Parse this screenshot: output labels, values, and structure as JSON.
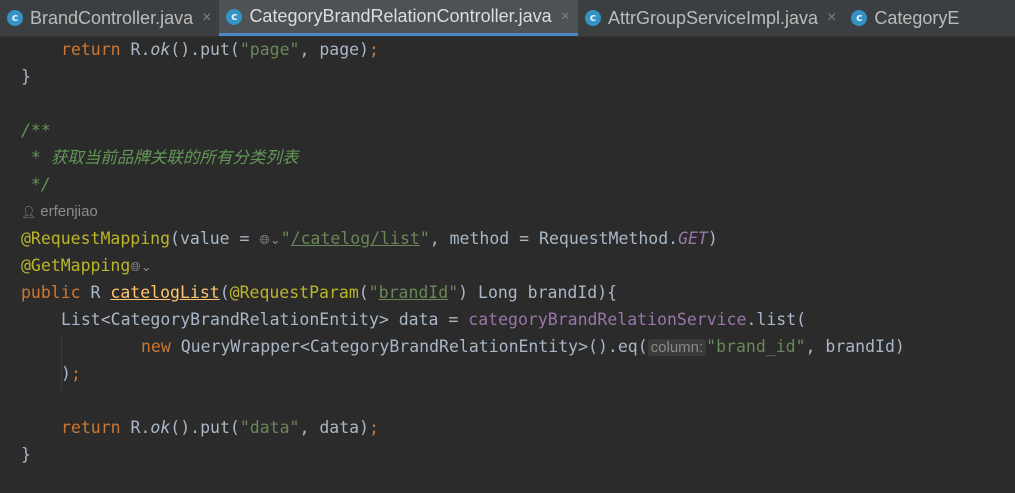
{
  "tabs": [
    {
      "label": "BrandController.java",
      "icon": "class-icon",
      "close": "×"
    },
    {
      "label": "CategoryBrandRelationController.java",
      "icon": "class-icon",
      "close": "×",
      "active": true
    },
    {
      "label": "AttrGroupServiceImpl.java",
      "icon": "class-icon",
      "close": "×"
    },
    {
      "label": "CategoryE",
      "icon": "class-icon"
    }
  ],
  "code": {
    "l1_kw": "return",
    "l1_rest": " R.",
    "l1_ok": "ok",
    "l1_put": "().put(",
    "l1_str": "\"page\"",
    "l1_tail": ", page)",
    "semicolon": ";",
    "close_brace": "}",
    "doc_open": "/**",
    "doc_star": " * ",
    "doc_text": "获取当前品牌关联的所有分类列表",
    "doc_close": " */",
    "author": "erfenjiao",
    "req_ann": "@RequestMapping",
    "req_open": "(value = ",
    "req_url_q1": "\"",
    "req_url": "/catelog/list",
    "req_url_q2": "\"",
    "req_mid": ", method = RequestMethod.",
    "req_get": "GET",
    "req_close": ")",
    "get_ann": "@GetMapping",
    "sig_public": "public",
    "sig_r": " R ",
    "sig_method": "catelogList",
    "sig_open": "(",
    "sig_param_ann": "@RequestParam",
    "sig_param_open": "(",
    "sig_param_q1": "\"",
    "sig_param_name": "brandId",
    "sig_param_q2": "\"",
    "sig_rest": ") Long brandId){",
    "list_decl": "List<CategoryBrandRelationEntity> data = ",
    "list_field": "categoryBrandRelationService",
    "list_call": ".list(",
    "new_kw": "new",
    "new_rest": " QueryWrapper<CategoryBrandRelationEntity>().eq(",
    "hint_column": "column:",
    "new_str": "\"brand_id\"",
    "new_tail": ", brandId)",
    "paren_close": ")",
    "ret_str": "\"data\"",
    "ret_tail": ", data)"
  },
  "icons": {
    "globe": "🌐︎",
    "chevron": "⌄",
    "person": "👤︎"
  },
  "colors": {
    "background": "#2b2b2b",
    "keyword": "#cc7832",
    "string": "#6a8759",
    "annotation": "#bbb529",
    "field": "#9876aa",
    "doc": "#629755",
    "active_tab_underline": "#4a88c7"
  }
}
